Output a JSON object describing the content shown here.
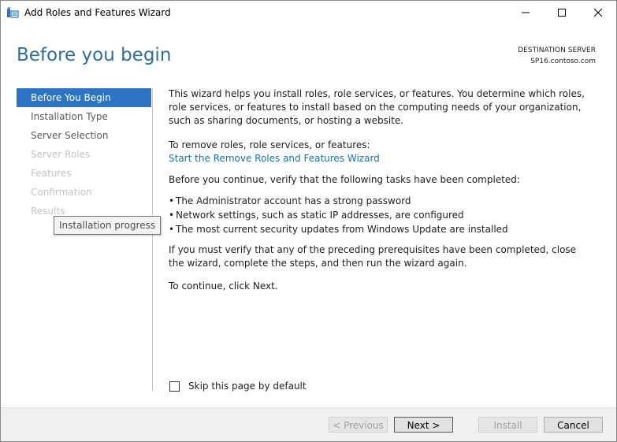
{
  "window": {
    "title": "Add Roles and Features Wizard",
    "icon": "server-manager-icon"
  },
  "header": {
    "page_title": "Before you begin",
    "destination_label": "DESTINATION SERVER",
    "destination_server": "SP16.contoso.com"
  },
  "nav": {
    "items": [
      {
        "label": "Before You Begin",
        "state": "active"
      },
      {
        "label": "Installation Type",
        "state": "enabled"
      },
      {
        "label": "Server Selection",
        "state": "enabled"
      },
      {
        "label": "Server Roles",
        "state": "disabled"
      },
      {
        "label": "Features",
        "state": "disabled"
      },
      {
        "label": "Confirmation",
        "state": "disabled"
      },
      {
        "label": "Results",
        "state": "disabled"
      }
    ],
    "tooltip": "Installation progress"
  },
  "content": {
    "intro": "This wizard helps you install roles, role services, or features. You determine which roles, role services, or features to install based on the computing needs of your organization, such as sharing documents, or hosting a website.",
    "remove_label": "To remove roles, role services, or features:",
    "remove_link": "Start the Remove Roles and Features Wizard",
    "verify_text": "Before you continue, verify that the following tasks have been completed:",
    "bullets": [
      "The Administrator account has a strong password",
      "Network settings, such as static IP addresses, are configured",
      "The most current security updates from Windows Update are installed"
    ],
    "must_verify": "If you must verify that any of the preceding prerequisites have been completed, close the wizard, complete the steps, and then run the wizard again.",
    "continue_text": "To continue, click Next."
  },
  "skip": {
    "label": "Skip this page by default",
    "checked": false
  },
  "footer": {
    "previous": "< Previous",
    "next": "Next >",
    "install": "Install",
    "cancel": "Cancel"
  },
  "colors": {
    "accent": "#2e74c4",
    "title": "#2e6e9e",
    "link": "#1e6fa8"
  }
}
